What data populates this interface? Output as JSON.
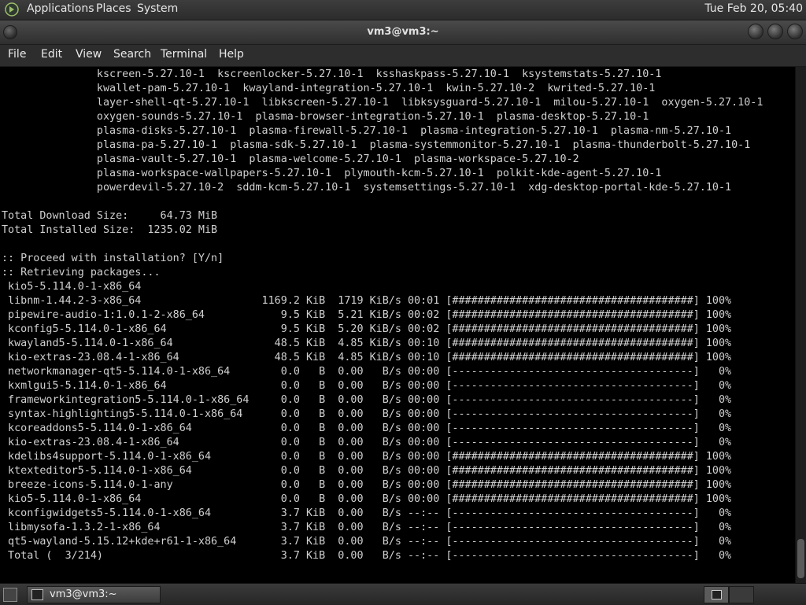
{
  "top_panel": {
    "menus": [
      "Applications",
      "Places",
      "System"
    ],
    "clock": "Tue Feb 20, 05:40"
  },
  "window": {
    "title": "vm3@vm3:~"
  },
  "menubar": [
    "File",
    "Edit",
    "View",
    "Search",
    "Terminal",
    "Help"
  ],
  "terminal": {
    "lines": [
      "               kscreen-5.27.10-1  kscreenlocker-5.27.10-1  ksshaskpass-5.27.10-1  ksystemstats-5.27.10-1",
      "               kwallet-pam-5.27.10-1  kwayland-integration-5.27.10-1  kwin-5.27.10-2  kwrited-5.27.10-1",
      "               layer-shell-qt-5.27.10-1  libkscreen-5.27.10-1  libksysguard-5.27.10-1  milou-5.27.10-1  oxygen-5.27.10-1",
      "               oxygen-sounds-5.27.10-1  plasma-browser-integration-5.27.10-1  plasma-desktop-5.27.10-1",
      "               plasma-disks-5.27.10-1  plasma-firewall-5.27.10-1  plasma-integration-5.27.10-1  plasma-nm-5.27.10-1",
      "               plasma-pa-5.27.10-1  plasma-sdk-5.27.10-1  plasma-systemmonitor-5.27.10-1  plasma-thunderbolt-5.27.10-1",
      "               plasma-vault-5.27.10-1  plasma-welcome-5.27.10-1  plasma-workspace-5.27.10-2",
      "               plasma-workspace-wallpapers-5.27.10-1  plymouth-kcm-5.27.10-1  polkit-kde-agent-5.27.10-1",
      "               powerdevil-5.27.10-2  sddm-kcm-5.27.10-1  systemsettings-5.27.10-1  xdg-desktop-portal-kde-5.27.10-1",
      "",
      "Total Download Size:     64.73 MiB",
      "Total Installed Size:  1235.02 MiB",
      "",
      ":: Proceed with installation? [Y/n]",
      ":: Retrieving packages...",
      " kio5-5.114.0-1-x86_64",
      " libnm-1.44.2-3-x86_64                   1169.2 KiB  1719 KiB/s 00:01 [######################################] 100%",
      " pipewire-audio-1:1.0.1-2-x86_64            9.5 KiB  5.21 KiB/s 00:02 [######################################] 100%",
      " kconfig5-5.114.0-1-x86_64                  9.5 KiB  5.20 KiB/s 00:02 [######################################] 100%",
      " kwayland5-5.114.0-1-x86_64                48.5 KiB  4.85 KiB/s 00:10 [######################################] 100%",
      " kio-extras-23.08.4-1-x86_64               48.5 KiB  4.85 KiB/s 00:10 [######################################] 100%",
      " networkmanager-qt5-5.114.0-1-x86_64        0.0   B  0.00   B/s 00:00 [--------------------------------------]   0%",
      " kxmlgui5-5.114.0-1-x86_64                  0.0   B  0.00   B/s 00:00 [--------------------------------------]   0%",
      " frameworkintegration5-5.114.0-1-x86_64     0.0   B  0.00   B/s 00:00 [--------------------------------------]   0%",
      " syntax-highlighting5-5.114.0-1-x86_64      0.0   B  0.00   B/s 00:00 [--------------------------------------]   0%",
      " kcoreaddons5-5.114.0-1-x86_64              0.0   B  0.00   B/s 00:00 [--------------------------------------]   0%",
      " kio-extras-23.08.4-1-x86_64                0.0   B  0.00   B/s 00:00 [--------------------------------------]   0%",
      " kdelibs4support-5.114.0-1-x86_64           0.0   B  0.00   B/s 00:00 [######################################] 100%",
      " ktexteditor5-5.114.0-1-x86_64              0.0   B  0.00   B/s 00:00 [######################################] 100%",
      " breeze-icons-5.114.0-1-any                 0.0   B  0.00   B/s 00:00 [######################################] 100%",
      " kio5-5.114.0-1-x86_64                      0.0   B  0.00   B/s 00:00 [######################################] 100%",
      " kconfigwidgets5-5.114.0-1-x86_64           3.7 KiB  0.00   B/s --:-- [--------------------------------------]   0%",
      " libmysofa-1.3.2-1-x86_64                   3.7 KiB  0.00   B/s --:-- [--------------------------------------]   0%",
      " qt5-wayland-5.15.12+kde+r61-1-x86_64       3.7 KiB  0.00   B/s --:-- [--------------------------------------]   0%",
      " Total (  3/214)                            3.7 KiB  0.00   B/s --:-- [--------------------------------------]   0%"
    ]
  },
  "taskbar": {
    "task_label": "vm3@vm3:~"
  },
  "colors": {
    "terminal_bg": "#000000",
    "terminal_fg": "#d0d0d0",
    "panel_bg": "#333333"
  }
}
